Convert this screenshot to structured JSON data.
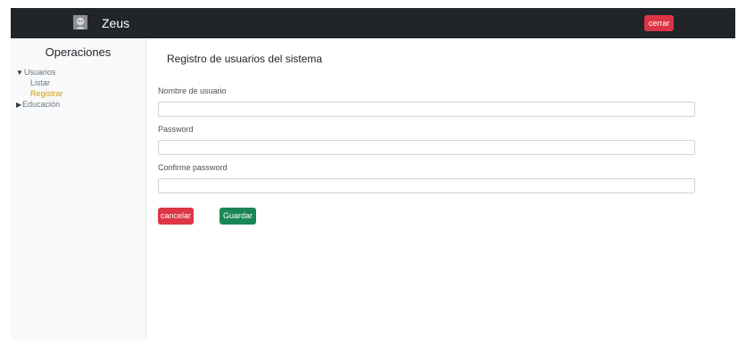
{
  "navbar": {
    "brand_logo": "face-logo",
    "brand_name": "Zeus",
    "logout_label": "cerrar",
    "background": "#212529"
  },
  "sidebar": {
    "title": "Operaciones",
    "groups": [
      {
        "label": "Usuarios",
        "caret": "▼",
        "expanded": true,
        "items": [
          {
            "label": "Listar",
            "active": false
          },
          {
            "label": "Registrar",
            "active": true
          }
        ]
      },
      {
        "label": "Educación",
        "caret": "▶",
        "expanded": false,
        "items": []
      }
    ]
  },
  "form": {
    "title": "Registro de usuarios del sistema",
    "fields": [
      {
        "label": "Nombre de usuario",
        "value": ""
      },
      {
        "label": "Password",
        "value": ""
      },
      {
        "label": "Confirme password",
        "value": ""
      }
    ],
    "cancel_label": "cancelar",
    "save_label": "Guardar"
  },
  "colors": {
    "danger": "#dc3545",
    "success": "#198754",
    "active_item": "#d39e00"
  }
}
